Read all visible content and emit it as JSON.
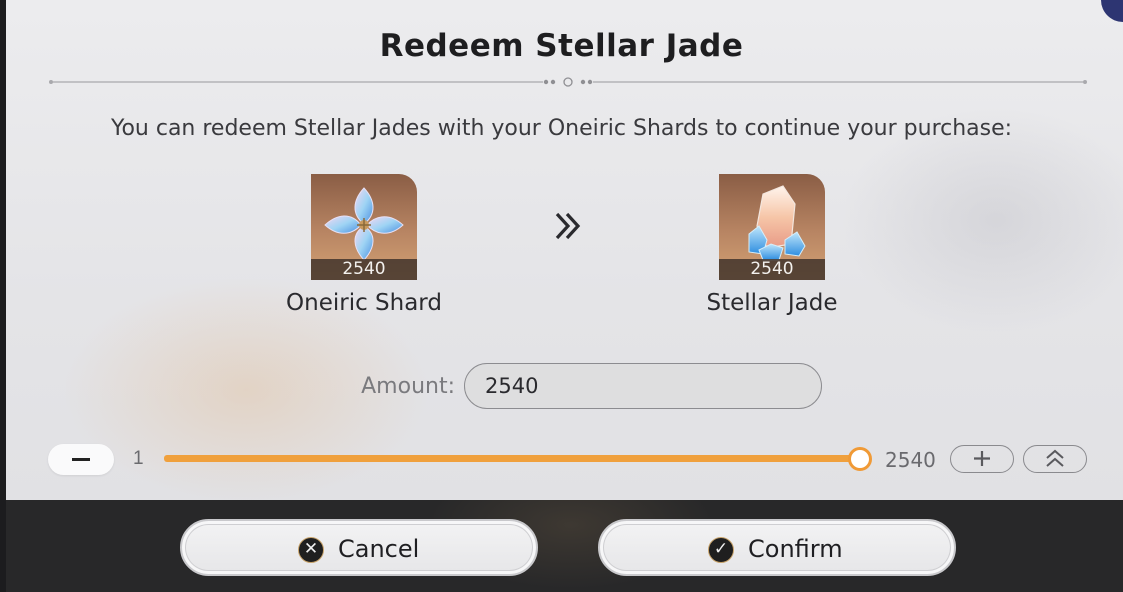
{
  "dialog": {
    "title": "Redeem Stellar Jade",
    "subtitle": "You can redeem Stellar Jades with your Oneiric Shards to continue your purchase:"
  },
  "source_item": {
    "name": "Oneiric Shard",
    "count": "2540",
    "icon": "oneiric-shard-icon"
  },
  "target_item": {
    "name": "Stellar Jade",
    "count": "2540",
    "icon": "stellar-jade-icon"
  },
  "exchange_arrow_icon": "double-chevron-right-icon",
  "amount": {
    "label": "Amount:",
    "value": "2540"
  },
  "slider": {
    "min_label": "1",
    "max_label": "2540",
    "value": 2540,
    "fill_fraction": 1.0,
    "accent_color": "#F09A36"
  },
  "controls": {
    "decrease_icon": "minus-icon",
    "increase_icon": "plus-icon",
    "max_icon": "double-chevron-up-icon"
  },
  "buttons": {
    "cancel_label": "Cancel",
    "cancel_icon": "close-circle-icon",
    "confirm_label": "Confirm",
    "confirm_icon": "check-circle-icon"
  }
}
